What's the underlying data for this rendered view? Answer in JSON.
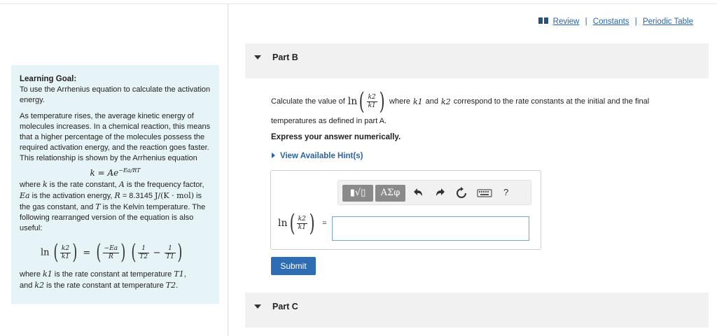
{
  "goal": {
    "title": "Learning Goal:",
    "intro": "To use the Arrhenius equation to calculate the activation energy.",
    "para1": "As temperature rises, the average kinetic energy of molecules increases. In a chemical reaction, this means that a higher percentage of the molecules possess the required activation energy, and the reaction goes faster. This relationship is shown by the Arrhenius equation",
    "eq1_lhs": "k = Ae",
    "eq1_exp": "−Ea/RT",
    "para2_a": "where ",
    "para2_k": "k",
    "para2_b": " is the rate constant, ",
    "para2_A": "A",
    "para2_c": " is the frequency factor, ",
    "para2_Ea": "Ea",
    "para2_d": " is the activation energy, ",
    "para2_R": "R",
    "para2_e": " = 8.3145",
    "para2_units": "J/(K · mol)",
    "para2_f": " is the gas constant, and ",
    "para2_T": "T",
    "para2_g": " is the Kelvin temperature. The following rearranged version of the equation is also useful:",
    "eq2": {
      "ln": "ln",
      "k2": "k2",
      "k1": "k1",
      "eq": "=",
      "negEa": "−Ea",
      "R": "R",
      "one": "1",
      "T2": "T2",
      "T1": "T1",
      "minus": "−"
    },
    "para3_a": "where ",
    "para3_k1": "k1",
    "para3_b": " is the rate constant at temperature ",
    "para3_T1": "T1",
    "para3_c": ",",
    "para3_d": "and ",
    "para3_k2": "k2",
    "para3_e": " is the rate constant at temperature ",
    "para3_T2": "T2",
    "para3_f": "."
  },
  "links": {
    "review": "Review",
    "constants": "Constants",
    "periodic_table": "Periodic Table",
    "separator": "|"
  },
  "partB": {
    "label": "Part B",
    "question_a": "Calculate the value of",
    "question_ln": "ln",
    "question_k2": "k2",
    "question_k1": "k1",
    "question_b": "where",
    "question_k1b": "k1",
    "question_and": "and",
    "question_k2b": "k2",
    "question_c": "correspond to the rate constants at the initial and the final",
    "question_line2": "temperatures as defined in part A.",
    "instruction": "Express your answer numerically.",
    "hint": "View Available Hint(s)",
    "toolbar": {
      "templates_glyph": "▮√▯",
      "greek_glyph": "ΑΣφ",
      "help": "?"
    },
    "answer_ln": "ln",
    "answer_k2": "k2",
    "answer_k1": "k1",
    "answer_eq": "=",
    "answer_value": "",
    "submit": "Submit"
  },
  "partC": {
    "label": "Part C"
  },
  "colors": {
    "accent": "#2e6db3",
    "link": "#2a63a8",
    "goal_bg": "#e6f3f7",
    "header_bg": "#f1f1f1"
  }
}
